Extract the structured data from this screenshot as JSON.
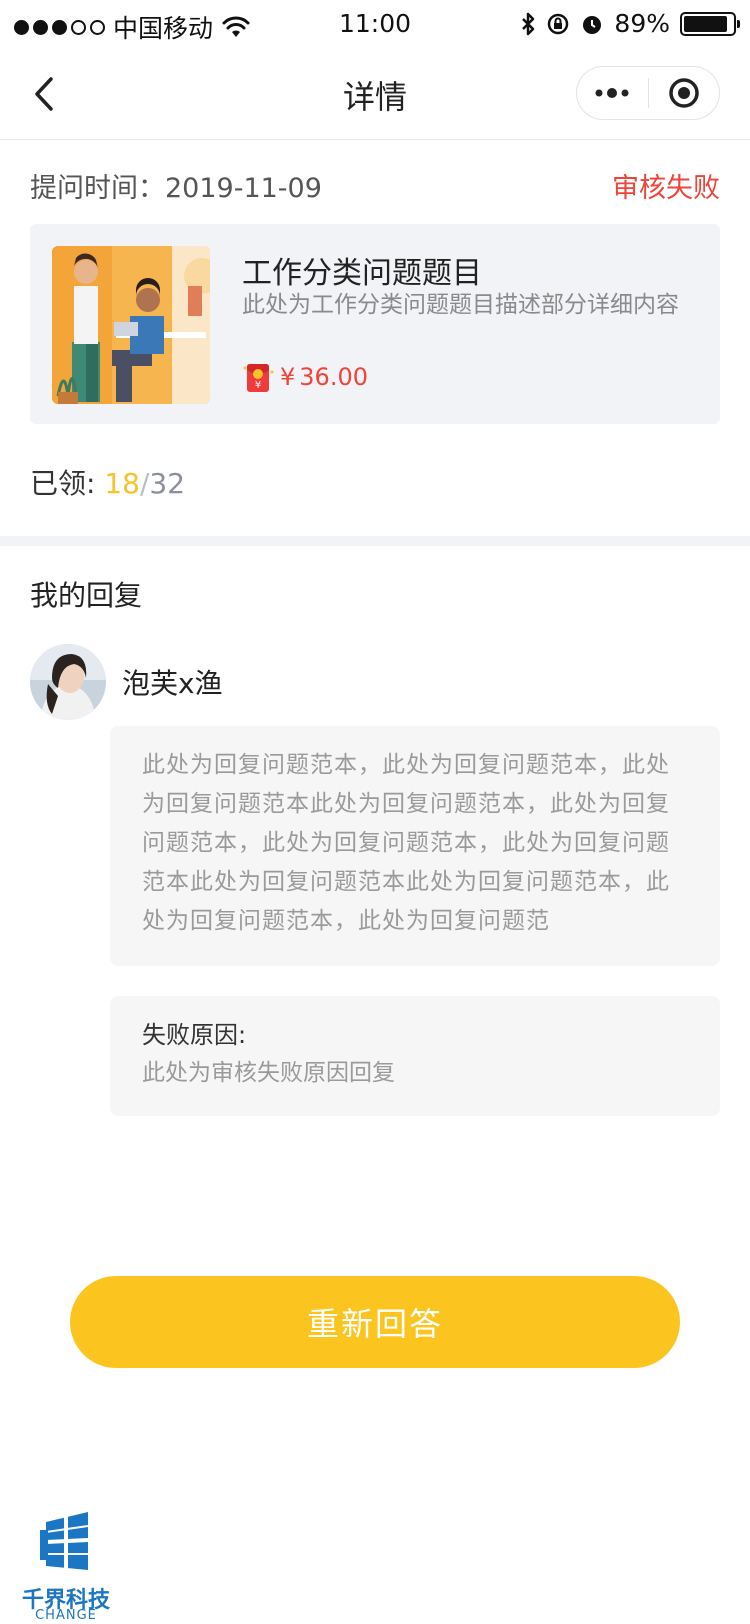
{
  "status_bar": {
    "carrier": "中国移动",
    "time": "11:00",
    "battery": "89%",
    "battery_level": 0.89
  },
  "nav": {
    "title": "详情"
  },
  "question": {
    "time_label": "提问时间：",
    "time_value": "2019-11-09",
    "status": "审核失败"
  },
  "card": {
    "title": "工作分类问题题目",
    "description": "此处为工作分类问题题目描述部分详细内容",
    "reward_symbol": "¥",
    "reward_amount": "36.00"
  },
  "claimed": {
    "label": "已领: ",
    "count": "18",
    "separator": "/",
    "total": "32"
  },
  "reply_section": {
    "title": "我的回复",
    "username": "泡芙x渔",
    "reply_text": "此处为回复问题范本，此处为回复问题范本，此处为回复问题范本此处为回复问题范本，此处为回复问题范本，此处为回复问题范本，此处为回复问题范本此处为回复问题范本此处为回复问题范本，此处为回复问题范本，此处为回复问题范",
    "reason_label": "失败原因:",
    "reason_text": "此处为审核失败原因回复"
  },
  "actions": {
    "reanswer_label": "重新回答"
  },
  "watermark": {
    "name": "千界科技",
    "sub": "CHANGE"
  },
  "colors": {
    "accent": "#fcc41e",
    "error": "#f0433a",
    "claimed": "#f9c12a"
  }
}
